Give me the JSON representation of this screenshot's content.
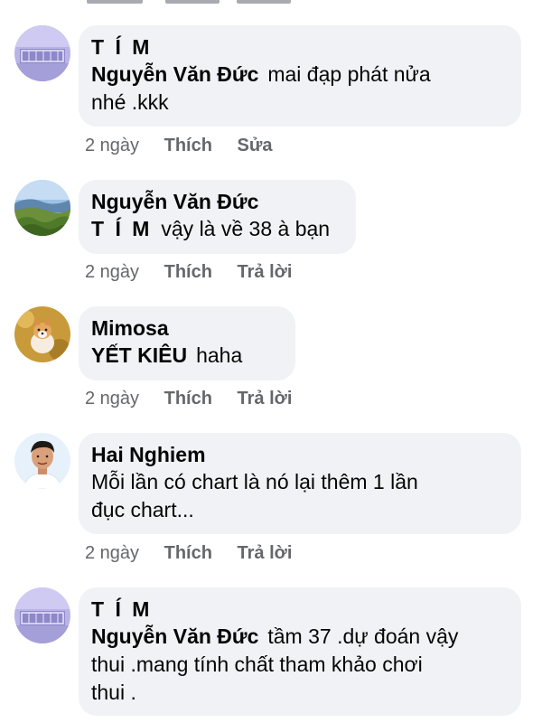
{
  "comments": [
    {
      "author": "T Í M",
      "tag": "Nguyễn Văn Đức",
      "text_line1": "mai đạp phát nửa",
      "text_line2": "nhé .kkk",
      "time": "2 ngày",
      "like": "Thích",
      "action": "Sửa",
      "avatar_icon": "gate-photo-avatar-icon"
    },
    {
      "author": "Nguyễn Văn Đức",
      "tag": "T Í M",
      "text_line1": "vậy là về 38 à bạn",
      "time": "2 ngày",
      "like": "Thích",
      "action": "Trả lời",
      "avatar_icon": "landscape-photo-avatar-icon"
    },
    {
      "author": "Mimosa",
      "tag": "YẾT KIÊU",
      "text_line1": "haha",
      "time": "2 ngày",
      "like": "Thích",
      "action": "Trả lời",
      "avatar_icon": "dog-photo-avatar-icon"
    },
    {
      "author": "Hai Nghiem",
      "text_line1": "Mỗi lần có chart là nó lại thêm 1 lần",
      "text_line2": "đục chart...",
      "time": "2 ngày",
      "like": "Thích",
      "action": "Trả lời",
      "avatar_icon": "man-photo-avatar-icon"
    },
    {
      "author": "T Í M",
      "tag": "Nguyễn Văn Đức",
      "text_line1": "tầm 37 .dự đoán vậy",
      "text_line2": "thui .mang tính chất tham khảo chơi",
      "text_line3": "thui .",
      "avatar_icon": "gate-photo-avatar-icon"
    }
  ],
  "colors": {
    "bubble_bg": "#f0f2f5",
    "meta_text": "#65676b",
    "text": "#050505"
  }
}
